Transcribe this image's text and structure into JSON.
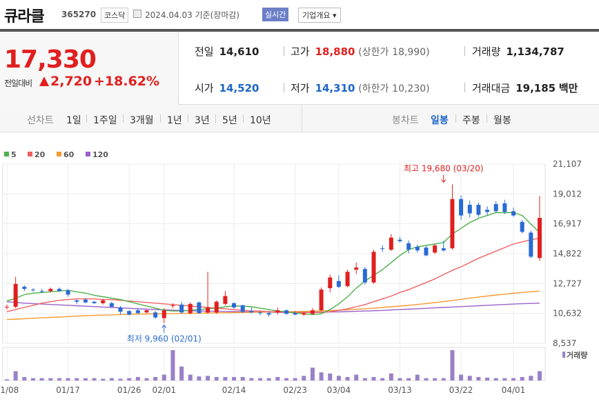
{
  "header": {
    "name": "큐라클",
    "code": "365270",
    "market": "코스닥",
    "date": "2024.04.03  기준(장마감)",
    "live_label": "실시간",
    "overview_label": "기업개요 ▾"
  },
  "quote": {
    "price": "17,330",
    "change_label": "전일대비",
    "change": "2,720",
    "change_pct": "+18.62%"
  },
  "stats": {
    "prev_label": "전일",
    "prev": "14,610",
    "high_label": "고가",
    "high": "18,880",
    "upper_label": "(상한가",
    "upper": "18,990)",
    "volume_label": "거래량",
    "volume": "1,134,787",
    "open_label": "시가",
    "open": "14,520",
    "low_label": "저가",
    "low": "14,310",
    "lower_label": "(하한가",
    "lower": "10,230)",
    "amount_label": "거래대금",
    "amount": "19,185",
    "amount_unit": "백만"
  },
  "tabs": {
    "line_label": "선차트",
    "periods": [
      "1일",
      "1주일",
      "3개월",
      "1년",
      "3년",
      "5년",
      "10년"
    ],
    "candle_label": "봉차트",
    "candle_periods": [
      "일봉",
      "주봉",
      "월봉"
    ],
    "candle_selected": "일봉"
  },
  "colors": {
    "up": "#e01f1f",
    "down": "#2a6ad4",
    "ma5": "#4cb04c",
    "ma20": "#f06060",
    "ma60": "#f49a30",
    "ma120": "#9a60c8",
    "volume": "#9a80c8"
  },
  "chart_data": {
    "type": "candlestick",
    "legend": [
      {
        "name": "5",
        "color": "#4cb04c"
      },
      {
        "name": "20",
        "color": "#f06060"
      },
      {
        "name": "60",
        "color": "#f49a30"
      },
      {
        "name": "120",
        "color": "#9a60c8"
      }
    ],
    "y_ticks": [
      "21,107",
      "19,012",
      "16,917",
      "14,822",
      "12,727",
      "10,632",
      "8,537"
    ],
    "ylim": [
      8537,
      21107
    ],
    "x_ticks": [
      {
        "label": "01/08",
        "i": 0
      },
      {
        "label": "01/17",
        "i": 7
      },
      {
        "label": "01/26",
        "i": 14
      },
      {
        "label": "02/01",
        "i": 18
      },
      {
        "label": "02/14",
        "i": 26
      },
      {
        "label": "02/23",
        "i": 33
      },
      {
        "label": "03/04",
        "i": 38
      },
      {
        "label": "03/13",
        "i": 45
      },
      {
        "label": "03/22",
        "i": 52
      },
      {
        "label": "04/01",
        "i": 58
      }
    ],
    "volume_label": "거래량",
    "annotations": {
      "high": {
        "text": "최고 19,680 (03/20)",
        "i": 50,
        "value": 19680
      },
      "low": {
        "text": "최저 9,960 (02/01)",
        "i": 18,
        "value": 9960
      }
    },
    "candles": [
      [
        11050,
        11250,
        10900,
        11100
      ],
      [
        11100,
        13200,
        11000,
        12700
      ],
      [
        12500,
        12600,
        12200,
        12350
      ],
      [
        12300,
        12400,
        12150,
        12250
      ],
      [
        12200,
        12350,
        12050,
        12150
      ],
      [
        12200,
        12450,
        12100,
        12350
      ],
      [
        12350,
        12450,
        12150,
        12200
      ],
      [
        12250,
        12350,
        11800,
        11950
      ],
      [
        11550,
        11600,
        11300,
        11450
      ],
      [
        11600,
        11700,
        11350,
        11400
      ],
      [
        11450,
        11500,
        11300,
        11350
      ],
      [
        11350,
        11650,
        11250,
        11550
      ],
      [
        11350,
        11450,
        11050,
        11100
      ],
      [
        11050,
        11150,
        10550,
        10750
      ],
      [
        10800,
        10850,
        10500,
        10550
      ],
      [
        10850,
        11000,
        10600,
        10650
      ],
      [
        10700,
        10900,
        10650,
        10850
      ],
      [
        10700,
        10800,
        10250,
        10350
      ],
      [
        10300,
        11000,
        9960,
        10850
      ],
      [
        11150,
        11350,
        11000,
        11200
      ],
      [
        11250,
        11450,
        10600,
        10700
      ],
      [
        10650,
        11400,
        10550,
        11300
      ],
      [
        11400,
        11450,
        10600,
        10650
      ],
      [
        10700,
        13550,
        10600,
        11050
      ],
      [
        10700,
        11550,
        10600,
        11450
      ],
      [
        11300,
        12200,
        11200,
        11850
      ],
      [
        11350,
        11400,
        10950,
        11050
      ],
      [
        11200,
        11250,
        10650,
        10750
      ],
      [
        10800,
        11050,
        10650,
        10700
      ],
      [
        10700,
        10800,
        10500,
        10650
      ],
      [
        10650,
        10800,
        10400,
        10550
      ],
      [
        10700,
        11050,
        10550,
        10850
      ],
      [
        10850,
        10900,
        10550,
        10600
      ],
      [
        10650,
        10800,
        10500,
        10550
      ],
      [
        10550,
        10750,
        10450,
        10650
      ],
      [
        10600,
        11000,
        10550,
        10850
      ],
      [
        10850,
        12450,
        10800,
        12300
      ],
      [
        12400,
        13350,
        12100,
        13150
      ],
      [
        12900,
        13300,
        12400,
        12500
      ],
      [
        12550,
        13700,
        12450,
        13550
      ],
      [
        13700,
        14200,
        13400,
        13850
      ],
      [
        13750,
        13900,
        12650,
        12800
      ],
      [
        12800,
        15100,
        12700,
        14950
      ],
      [
        15200,
        15400,
        14950,
        15150
      ],
      [
        15100,
        16200,
        15000,
        15950
      ],
      [
        15800,
        16000,
        15600,
        15700
      ],
      [
        15550,
        15750,
        14850,
        15100
      ],
      [
        15300,
        15450,
        14900,
        15050
      ],
      [
        15250,
        15350,
        14650,
        14700
      ],
      [
        14900,
        15500,
        14800,
        15400
      ],
      [
        15200,
        15750,
        14950,
        15050
      ],
      [
        15200,
        19680,
        15100,
        18650
      ],
      [
        18650,
        18900,
        17200,
        17500
      ],
      [
        18250,
        18550,
        17350,
        17650
      ],
      [
        18250,
        18400,
        17400,
        17550
      ],
      [
        17900,
        18150,
        17500,
        17750
      ],
      [
        18300,
        18500,
        17700,
        17800
      ],
      [
        18350,
        18600,
        17600,
        17750
      ],
      [
        17800,
        18050,
        17400,
        17500
      ],
      [
        17050,
        17200,
        16250,
        16350
      ],
      [
        16300,
        16450,
        14500,
        14610
      ],
      [
        14520,
        18880,
        14310,
        17330
      ]
    ],
    "ma5": [
      11500,
      11700,
      11950,
      12050,
      12100,
      12150,
      12200,
      12250,
      12150,
      12050,
      11900,
      11800,
      11700,
      11600,
      11450,
      11300,
      11150,
      11000,
      10850,
      10800,
      10800,
      10850,
      10900,
      10950,
      11000,
      11100,
      11150,
      11150,
      11100,
      11000,
      10900,
      10800,
      10750,
      10650,
      10600,
      10550,
      10600,
      10900,
      11300,
      11800,
      12400,
      12900,
      13300,
      13700,
      14200,
      14700,
      15100,
      15300,
      15400,
      15500,
      15600,
      16200,
      16600,
      17000,
      17300,
      17500,
      17700,
      17700,
      17700,
      17500,
      16900,
      16300
    ],
    "ma20": [
      10750,
      10900,
      11050,
      11200,
      11350,
      11450,
      11550,
      11600,
      11650,
      11650,
      11650,
      11600,
      11600,
      11550,
      11500,
      11450,
      11400,
      11350,
      11300,
      11250,
      11200,
      11150,
      11100,
      11050,
      11000,
      10950,
      10900,
      10850,
      10800,
      10800,
      10750,
      10750,
      10700,
      10700,
      10700,
      10700,
      10700,
      10750,
      10850,
      10950,
      11100,
      11250,
      11450,
      11650,
      11850,
      12100,
      12300,
      12550,
      12800,
      13050,
      13350,
      13650,
      13900,
      14200,
      14500,
      14750,
      15000,
      15250,
      15500,
      15650,
      15800,
      15900
    ],
    "ma60": [
      10200,
      10230,
      10260,
      10290,
      10320,
      10350,
      10380,
      10410,
      10440,
      10470,
      10490,
      10510,
      10530,
      10550,
      10570,
      10580,
      10590,
      10600,
      10610,
      10620,
      10630,
      10640,
      10650,
      10660,
      10670,
      10680,
      10690,
      10700,
      10710,
      10720,
      10730,
      10740,
      10750,
      10760,
      10770,
      10790,
      10810,
      10830,
      10860,
      10890,
      10920,
      10960,
      11000,
      11050,
      11100,
      11150,
      11200,
      11260,
      11320,
      11390,
      11460,
      11540,
      11620,
      11700,
      11780,
      11850,
      11920,
      11980,
      12040,
      12100,
      12150,
      12200
    ],
    "ma120": [
      11450,
      11400,
      11350,
      11320,
      11290,
      11260,
      11230,
      11200,
      11170,
      11140,
      11110,
      11080,
      11050,
      11020,
      10990,
      10960,
      10930,
      10900,
      10880,
      10860,
      10840,
      10820,
      10800,
      10790,
      10780,
      10770,
      10760,
      10750,
      10740,
      10730,
      10720,
      10710,
      10700,
      10700,
      10700,
      10710,
      10720,
      10730,
      10740,
      10760,
      10780,
      10800,
      10820,
      10840,
      10870,
      10900,
      10930,
      10960,
      10990,
      11020,
      11050,
      11080,
      11110,
      11140,
      11170,
      11200,
      11230,
      11260,
      11290,
      11310,
      11330,
      11350
    ],
    "volume": [
      2,
      16,
      6,
      4,
      4,
      4,
      4,
      4,
      4,
      4,
      4,
      3,
      4,
      3,
      4,
      6,
      4,
      6,
      10,
      52,
      24,
      10,
      7,
      8,
      6,
      6,
      6,
      6,
      4,
      4,
      4,
      6,
      4,
      4,
      8,
      22,
      14,
      12,
      8,
      6,
      10,
      4,
      6,
      4,
      12,
      4,
      4,
      10,
      4,
      4,
      4,
      52,
      10,
      8,
      6,
      5,
      4,
      4,
      4,
      6,
      8,
      16
    ]
  }
}
